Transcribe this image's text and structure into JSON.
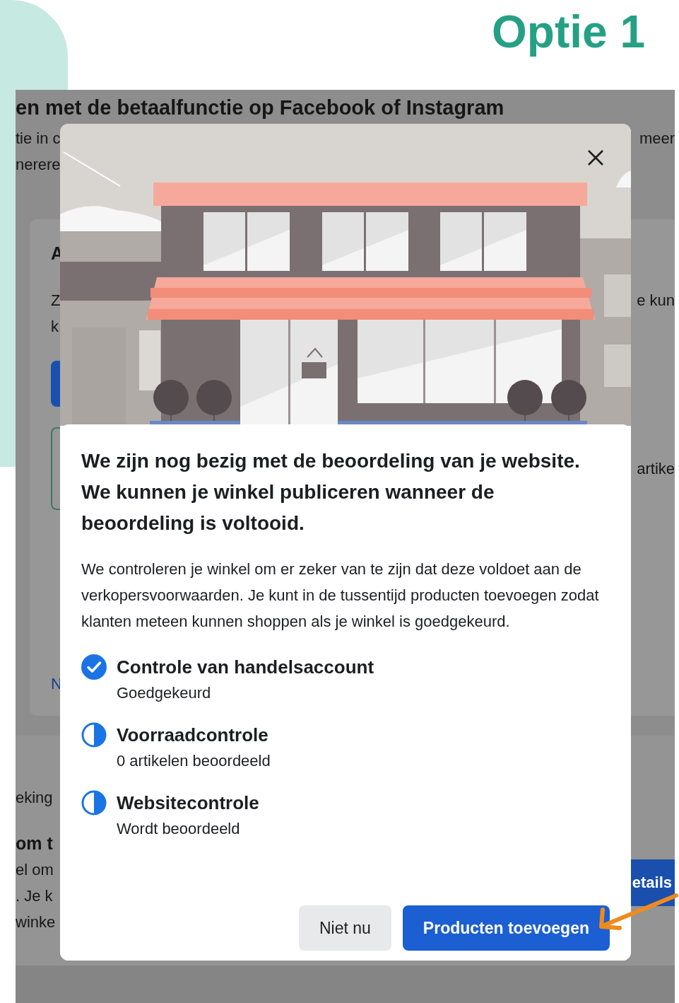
{
  "heading": "Optie 1",
  "background": {
    "title": "en met de betaalfunctie op Facebook of Instagram",
    "intro": [
      {
        "left": "tie in c",
        "right": "meer"
      },
      {
        "left": "nerere"
      }
    ],
    "card": [
      {
        "kind": "heading",
        "left": "A"
      },
      {
        "kind": "text",
        "left": "Z",
        "right": "e kun"
      },
      {
        "kind": "text",
        "left": "k"
      },
      {
        "kind": "button"
      },
      {
        "kind": "box",
        "right": "artike"
      },
      {
        "kind": "link",
        "left": "N"
      }
    ],
    "section": {
      "lines": [
        {
          "kind": "text",
          "left": "eking"
        },
        {
          "kind": "heading",
          "left": "om t"
        },
        {
          "kind": "text",
          "left": "el om"
        },
        {
          "kind": "text",
          "left": ". Je k"
        },
        {
          "kind": "text",
          "left": "winke"
        }
      ],
      "button": "etails"
    }
  },
  "dialog": {
    "title": "We zijn nog bezig met de beoordeling van je website. We kunnen je winkel publiceren wanneer de beoordeling is voltooid.",
    "body": "We controleren je winkel om er zeker van te zijn dat deze voldoet aan de verkopersvoorwaarden. Je kunt in de tussentijd producten toevoegen zodat klanten meteen kunnen shoppen als je winkel is goedgekeurd.",
    "checks": [
      {
        "kind": "done",
        "title": "Controle van handelsaccount",
        "status": "Goedgekeurd"
      },
      {
        "kind": "pending",
        "title": "Voorraadcontrole",
        "status": "0 artikelen beoordeeld"
      },
      {
        "kind": "pending",
        "title": "Websitecontrole",
        "status": "Wordt beoordeeld"
      }
    ],
    "buttons": [
      {
        "kind": "secondary",
        "label": "Niet nu"
      },
      {
        "kind": "primary",
        "label": "Producten toevoegen"
      }
    ]
  }
}
